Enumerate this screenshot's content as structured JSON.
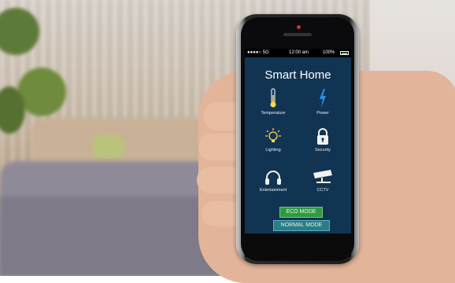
{
  "status_bar": {
    "signal": "●●●●○ 5G",
    "time": "12:00 am",
    "battery": "100%",
    "battery_level": 1.0
  },
  "app": {
    "title": "Smart Home"
  },
  "items": [
    {
      "label": "Temperature",
      "icon": "thermometer-icon"
    },
    {
      "label": "Power",
      "icon": "lightning-icon"
    },
    {
      "label": "Lighting",
      "icon": "lightbulb-icon"
    },
    {
      "label": "Security",
      "icon": "padlock-icon"
    },
    {
      "label": "Entertainment",
      "icon": "headphones-icon"
    },
    {
      "label": "CCTV",
      "icon": "cctv-camera-icon"
    }
  ],
  "buttons": {
    "eco": "ECO MODE",
    "normal": "NORMAL MODE"
  },
  "colors": {
    "screen_bg": "#123453",
    "accent_yellow": "#ffd84a",
    "icon_blue": "#2f8fe8",
    "eco_green": "#2f9a42",
    "normal_teal": "#2a7c86"
  }
}
